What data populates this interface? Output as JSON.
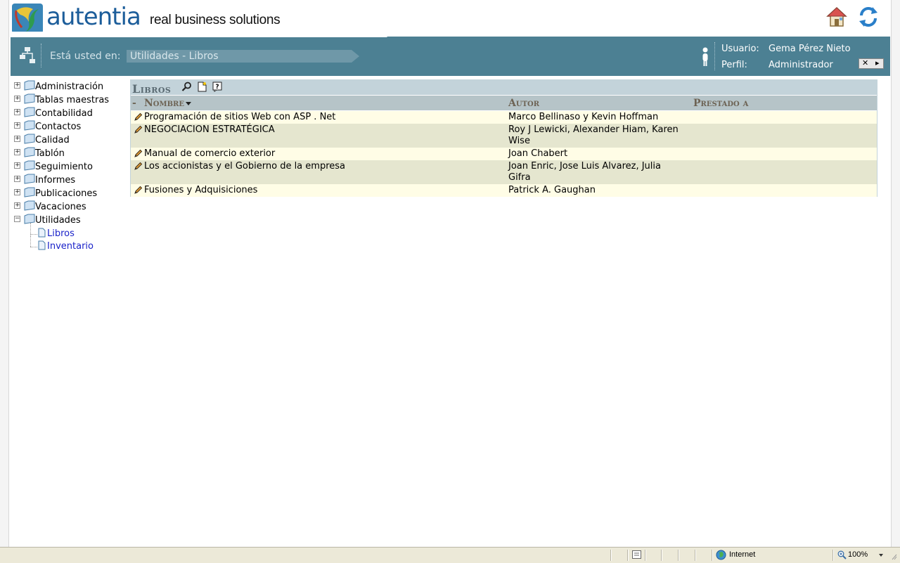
{
  "header": {
    "logo_text": "autentia",
    "tagline": "real business solutions",
    "home_icon": "home-icon",
    "refresh_icon": "refresh-icon"
  },
  "breadcrumb": {
    "label": "Está usted en:",
    "path": "Utilidades - Libros"
  },
  "user": {
    "usuario_label": "Usuario:",
    "usuario_value": "Gema Pérez Nieto",
    "perfil_label": "Perfil:",
    "perfil_value": "Administrador",
    "close_glyph": "✕",
    "arrow_glyph": "▸"
  },
  "tree": {
    "items": [
      {
        "label": "Administración",
        "toggle": "+"
      },
      {
        "label": "Tablas maestras",
        "toggle": "+"
      },
      {
        "label": "Contabilidad",
        "toggle": "+"
      },
      {
        "label": "Contactos",
        "toggle": "+"
      },
      {
        "label": "Calidad",
        "toggle": "+"
      },
      {
        "label": "Tablón",
        "toggle": "+"
      },
      {
        "label": "Seguimiento",
        "toggle": "+"
      },
      {
        "label": "Informes",
        "toggle": "+"
      },
      {
        "label": "Publicaciones",
        "toggle": "+"
      },
      {
        "label": "Vacaciones",
        "toggle": "+"
      },
      {
        "label": "Utilidades",
        "toggle": "−"
      }
    ],
    "children": [
      {
        "label": "Libros"
      },
      {
        "label": "Inventario"
      }
    ]
  },
  "panel": {
    "title": "Libros",
    "columns": {
      "dash": "-",
      "nombre": "Nombre",
      "autor": "Autor",
      "prestado": "Prestado a"
    },
    "rows": [
      {
        "nombre": "Programación de sitios Web con ASP . Net",
        "autor_l1": "Marco Bellinaso y Kevin Hoffman",
        "autor_l2": "",
        "prestado": ""
      },
      {
        "nombre": "NEGOCIACION ESTRATÉGICA",
        "autor_l1": "Roy J Lewicki, Alexander Hiam, Karen",
        "autor_l2": "Wise",
        "prestado": ""
      },
      {
        "nombre": "Manual de comercio exterior",
        "autor_l1": "Joan Chabert",
        "autor_l2": "",
        "prestado": ""
      },
      {
        "nombre": "Los accionistas y el Gobierno de la empresa",
        "autor_l1": "Joan Enric, Jose Luis Alvarez, Julia",
        "autor_l2": "Gifra",
        "prestado": ""
      },
      {
        "nombre": "Fusiones y Adquisiciones",
        "autor_l1": "Patrick A. Gaughan",
        "autor_l2": "",
        "prestado": ""
      }
    ]
  },
  "statusbar": {
    "zone": "Internet",
    "zoom": "100%"
  },
  "colors": {
    "bar": "#4c8093",
    "row_odd": "#fffde6",
    "row_even": "#e5e6cf",
    "link": "#1a22c9"
  }
}
